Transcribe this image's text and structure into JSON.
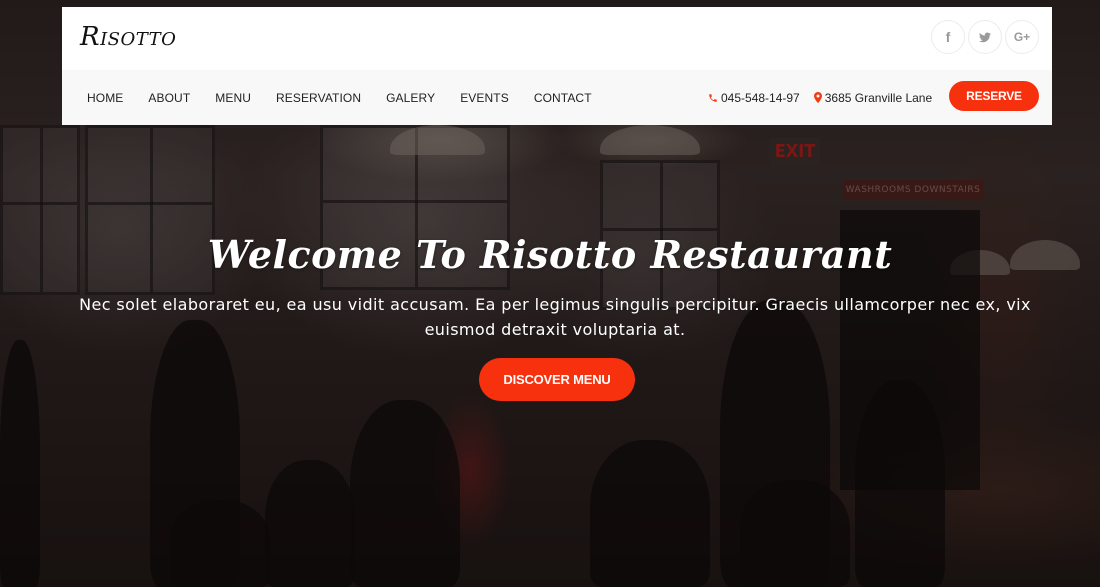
{
  "header": {
    "logo": "Risotto",
    "social": [
      {
        "name": "facebook",
        "icon": "f"
      },
      {
        "name": "twitter",
        "icon": "twitter-bird"
      },
      {
        "name": "google-plus",
        "icon": "G+"
      }
    ],
    "nav": [
      {
        "label": "HOME"
      },
      {
        "label": "ABOUT"
      },
      {
        "label": "MENU"
      },
      {
        "label": "RESERVATION"
      },
      {
        "label": "GALERY"
      },
      {
        "label": "EVENTS"
      },
      {
        "label": "CONTACT"
      }
    ],
    "phone": {
      "icon": "phone-icon",
      "text": "045-548-14-97"
    },
    "address": {
      "icon": "map-pin-icon",
      "text": "3685 Granville Lane"
    },
    "reserve_label": "RESERVE"
  },
  "hero": {
    "title": "Welcome To Risotto Restaurant",
    "text": "Nec solet elaboraret eu, ea usu vidit accusam. Ea per legimus singulis percipitur. Graecis ullamcorper nec ex, vix euismod detraxit voluptaria at.",
    "cta_label": "DISCOVER MENU"
  },
  "background": {
    "exit_sign": "EXIT",
    "wall_sign": "WASHROOMS DOWNSTAIRS"
  },
  "colors": {
    "accent": "#f7310d",
    "header_bg": "#ffffff",
    "nav_bg": "#f8f8f8",
    "text_dark": "#222222"
  }
}
